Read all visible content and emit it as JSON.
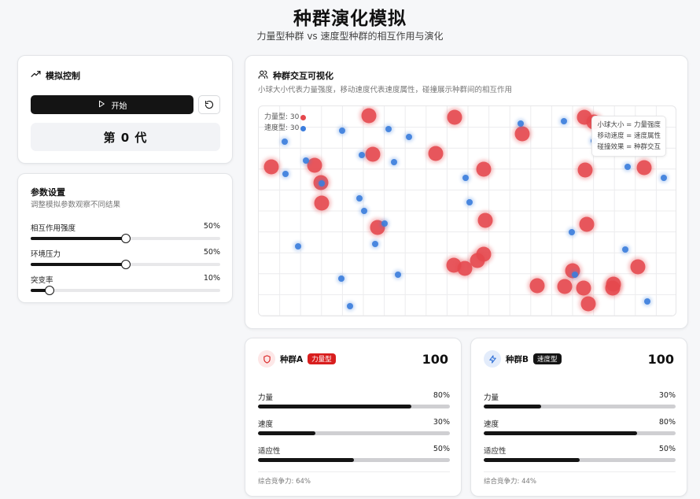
{
  "header": {
    "title": "种群演化模拟",
    "subtitle": "力量型种群 vs 速度型种群的相互作用与演化"
  },
  "control": {
    "title": "模拟控制",
    "icon": "trending-up-icon",
    "start_label": "开始",
    "generation_text": "第 0 代"
  },
  "params": {
    "title": "参数设置",
    "desc": "调整模拟参数观察不同结果",
    "items": [
      {
        "label": "相互作用强度",
        "value_text": "50%",
        "value": 0.5
      },
      {
        "label": "环境压力",
        "value_text": "50%",
        "value": 0.5
      },
      {
        "label": "突变率",
        "value_text": "10%",
        "value": 0.1
      }
    ]
  },
  "viz": {
    "title": "种群交互可视化",
    "desc": "小球大小代表力量强度，移动速度代表速度属性，碰撞展示种群间的相互作用",
    "legend_power": "力量型: 30",
    "legend_speed": "速度型: 30",
    "info_lines": [
      "小球大小 = 力量强度",
      "移动速度 = 速度属性",
      "碰撞效果 = 种群交互"
    ],
    "colors": {
      "power": "#e5484d",
      "speed": "#3b7ddd"
    }
  },
  "species": [
    {
      "name": "种群A",
      "badge": "力量型",
      "badge_color": "#d81e1e",
      "icon": "shield-icon",
      "total": "100",
      "stats": [
        {
          "label": "力量",
          "value_text": "80%",
          "value": 0.8
        },
        {
          "label": "速度",
          "value_text": "30%",
          "value": 0.3
        },
        {
          "label": "适应性",
          "value_text": "50%",
          "value": 0.5
        }
      ],
      "footer": "综合竞争力: 64%"
    },
    {
      "name": "种群B",
      "badge": "速度型",
      "badge_color": "#141414",
      "icon": "lightning-icon",
      "total": "100",
      "stats": [
        {
          "label": "力量",
          "value_text": "30%",
          "value": 0.3
        },
        {
          "label": "速度",
          "value_text": "80%",
          "value": 0.8
        },
        {
          "label": "适应性",
          "value_text": "50%",
          "value": 0.5
        }
      ],
      "footer": "综合竞争力: 44%"
    }
  ]
}
